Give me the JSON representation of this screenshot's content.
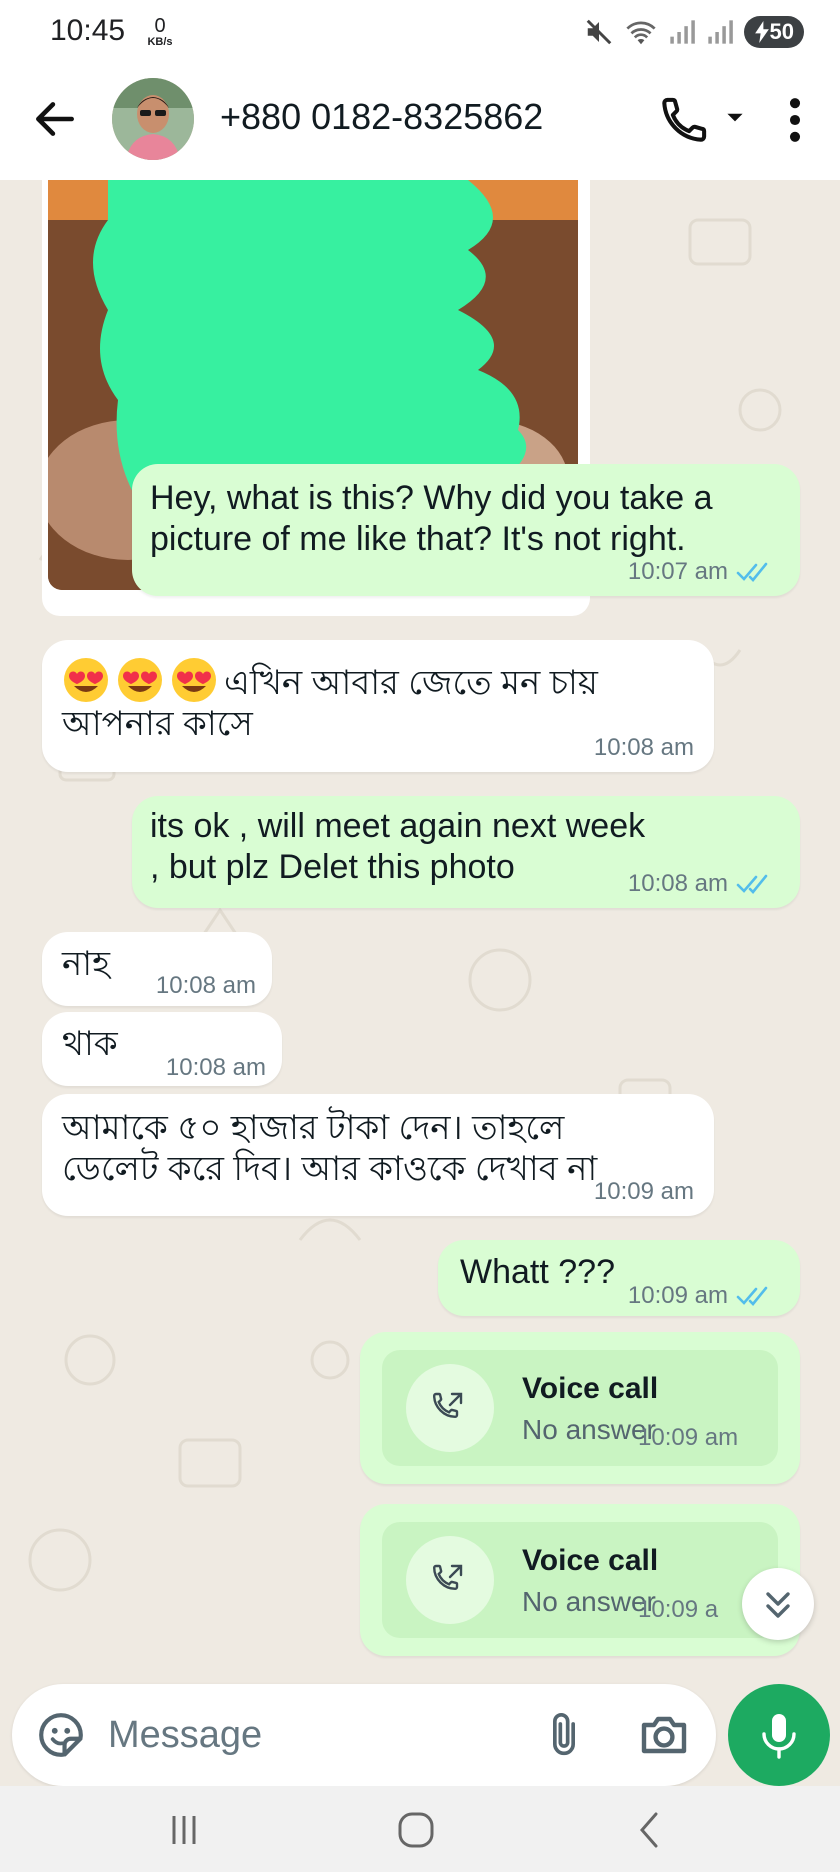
{
  "status_bar": {
    "time": "10:45",
    "net_speed_value": "0",
    "net_speed_unit": "KB/s",
    "battery": "50"
  },
  "header": {
    "contact_name": "+880 0182-8325862"
  },
  "messages": [
    {
      "direction": "outgoing",
      "text": "Hey, what is this? Why did you take a picture of me like that? It's not right.",
      "time": "10:07 am",
      "status": "read"
    },
    {
      "direction": "incoming",
      "emoji": "heart-eyes x3",
      "text": "এখিন আবার জেতে মন চায় আপনার কাসে",
      "time": "10:08 am"
    },
    {
      "direction": "outgoing",
      "text": "its ok , will meet again next week , but plz Delet this photo",
      "time": "10:08 am",
      "status": "read"
    },
    {
      "direction": "incoming",
      "text": "নাহ",
      "time": "10:08 am"
    },
    {
      "direction": "incoming",
      "text": "থাক",
      "time": "10:08 am"
    },
    {
      "direction": "incoming",
      "text": "আমাকে ৫০ হাজার টাকা দেন। তাহলে ডেলেট করে দিব।  আর কাওকে দেখাব না",
      "time": "10:09 am"
    },
    {
      "direction": "outgoing",
      "text": "Whatt ???",
      "time": "10:09 am",
      "status": "read"
    },
    {
      "direction": "outgoing",
      "type": "call",
      "title": "Voice call",
      "subtitle": "No answer",
      "time": "10:09 am"
    },
    {
      "direction": "outgoing",
      "type": "call",
      "title": "Voice call",
      "subtitle": "No answer",
      "time": "10:09 a"
    }
  ],
  "composer": {
    "placeholder": "Message"
  },
  "colors": {
    "incoming_bubble": "#ffffff",
    "outgoing_bubble": "#d9fdd3",
    "chat_background": "#efeae2",
    "read_ticks": "#53bdeb",
    "mic_button": "#1daa61"
  },
  "icons": [
    "back-arrow-icon",
    "phone-icon",
    "caret-down-icon",
    "more-vert-icon",
    "read-ticks-icon",
    "outgoing-call-icon",
    "double-chevron-down-icon",
    "sticker-icon",
    "paperclip-icon",
    "camera-icon",
    "mic-icon",
    "recents-icon",
    "home-icon",
    "back-icon"
  ]
}
